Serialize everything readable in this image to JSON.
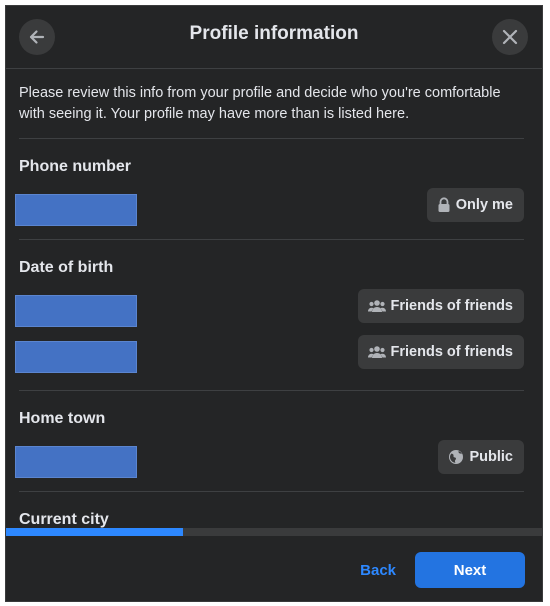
{
  "dialog": {
    "title": "Profile information",
    "intro": "Please review this info from your profile and decide who you're comfortable with seeing it. Your profile may have more than is listed here."
  },
  "sections": [
    {
      "title": "Phone number",
      "items": [
        {
          "privacy": "Only me",
          "icon": "lock-icon",
          "value_redacted": true
        }
      ]
    },
    {
      "title": "Date of birth",
      "items": [
        {
          "privacy": "Friends of friends",
          "icon": "friends-icon",
          "value_redacted": true
        },
        {
          "privacy": "Friends of friends",
          "icon": "friends-icon",
          "value_redacted": true
        }
      ]
    },
    {
      "title": "Home town",
      "items": [
        {
          "privacy": "Public",
          "icon": "globe-icon",
          "value_redacted": true
        }
      ]
    },
    {
      "title": "Current city",
      "items": []
    }
  ],
  "progress": {
    "fraction": 0.33
  },
  "footer": {
    "back_label": "Back",
    "next_label": "Next"
  },
  "colors": {
    "background": "#242526",
    "button_bg": "#3a3b3c",
    "accent": "#2d88ff",
    "primary_button": "#2374e1",
    "redaction": "#4472c4"
  }
}
